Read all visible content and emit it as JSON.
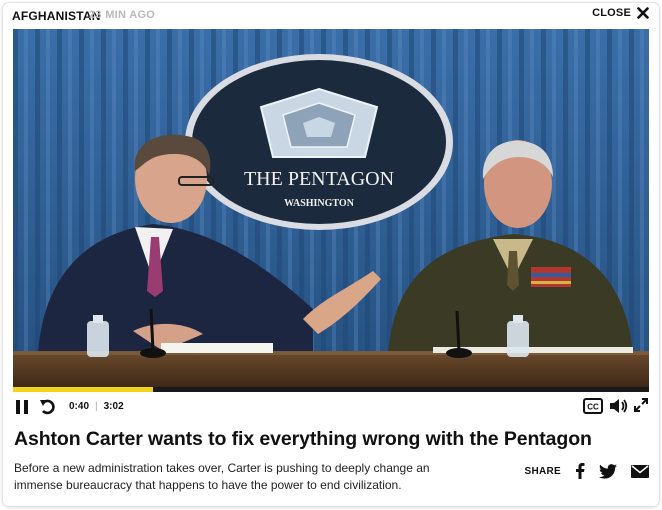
{
  "header": {
    "category": "AFGHANISTAN",
    "timestamp": "23 MIN AGO",
    "close_label": "CLOSE"
  },
  "video": {
    "seal_title": "THE PENTAGON",
    "seal_subtitle": "WASHINGTON",
    "progress": 0.22,
    "current_time": "0:40",
    "duration": "3:02",
    "cc_label": "CC"
  },
  "article": {
    "headline": "Ashton Carter wants to fix everything wrong with the Pentagon",
    "dek": "Before a new administration takes over, Carter is pushing to deeply change an immense bureaucracy that happens to have the power to end civilization."
  },
  "share": {
    "label": "SHARE",
    "networks": [
      "facebook-icon",
      "twitter-icon",
      "email-icon"
    ]
  },
  "colors": {
    "accent": "#f3d21b",
    "curtain": "#2f5f99",
    "timestamp": "#b9b9b9"
  }
}
